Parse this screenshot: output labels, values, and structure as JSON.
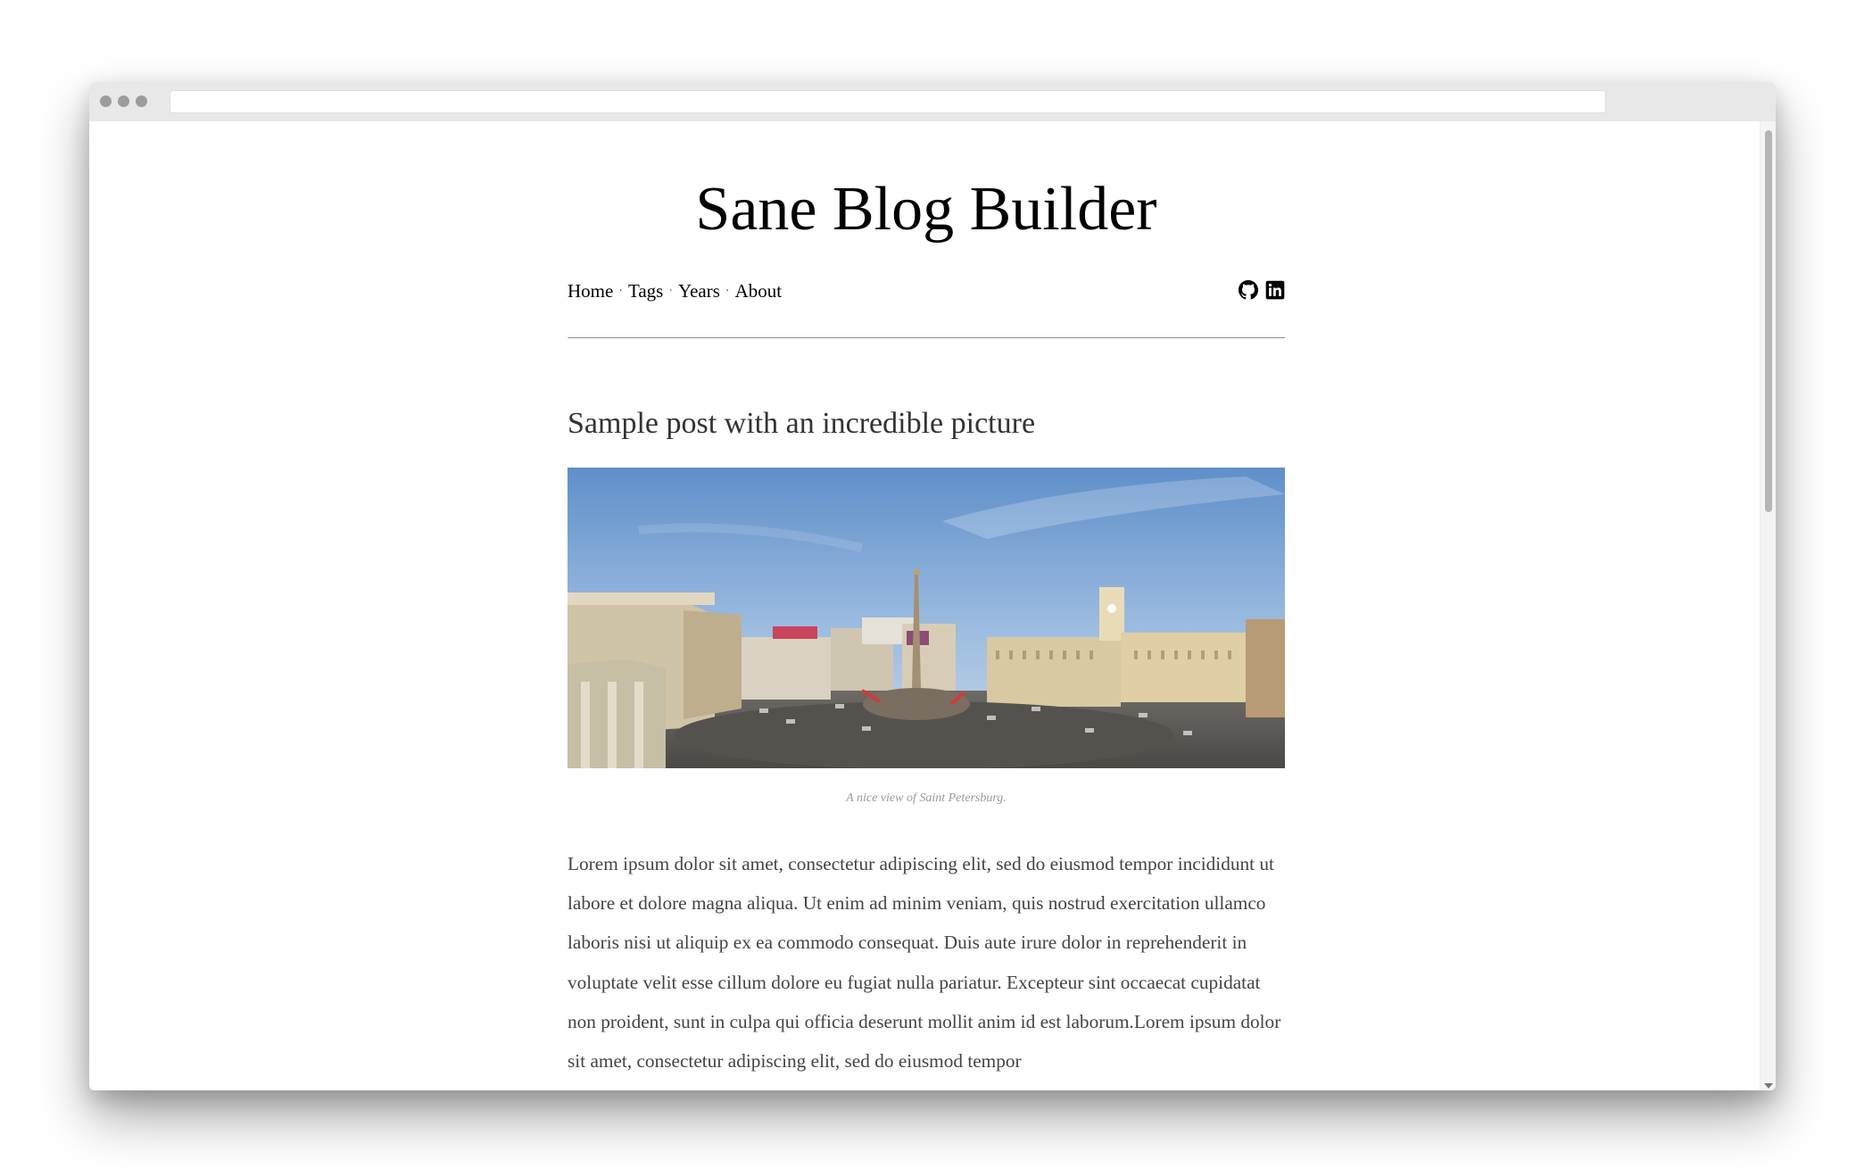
{
  "window": {
    "url": ""
  },
  "site": {
    "title": "Sane Blog Builder"
  },
  "nav": {
    "items": [
      "Home",
      "Tags",
      "Years",
      "About"
    ],
    "separator": "·",
    "social_icons": [
      "github-icon",
      "linkedin-icon"
    ]
  },
  "post": {
    "title": "Sample post with an incredible picture",
    "image_caption": "A nice view of Saint Petersburg.",
    "body": "Lorem ipsum dolor sit amet, consectetur adipiscing elit, sed do eiusmod tempor incididunt ut labore et dolore magna aliqua. Ut enim ad minim veniam, quis nostrud exercitation ullamco laboris nisi ut aliquip ex ea commodo consequat. Duis aute irure dolor in reprehenderit in voluptate velit esse cillum dolore eu fugiat nulla pariatur. Excepteur sint occaecat cupidatat non proident, sunt in culpa qui officia deserunt mollit anim id est laborum.Lorem ipsum dolor sit amet, consectetur adipiscing elit, sed do eiusmod tempor"
  },
  "colors": {
    "page_background": "#ffffff",
    "titlebar": "#e8e8e8",
    "title_text": "#000000",
    "post_text": "#444444",
    "caption_text": "#999999",
    "divider": "#8f8f8f"
  }
}
